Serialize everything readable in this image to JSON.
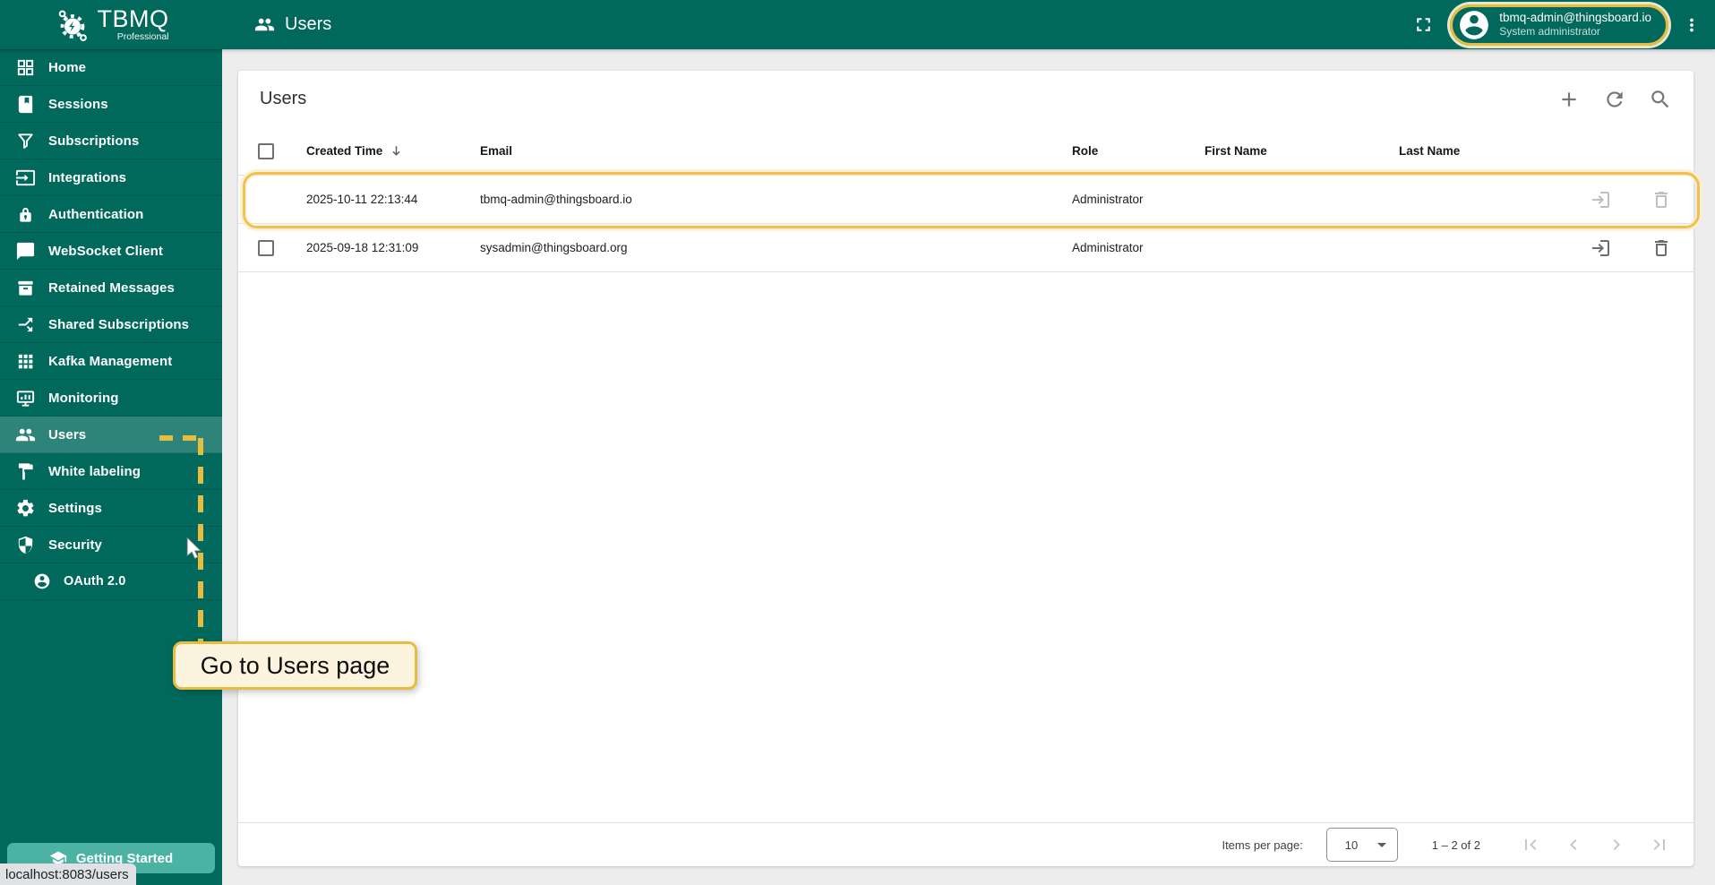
{
  "brand": {
    "name": "TBMQ",
    "edition": "Professional"
  },
  "topbar": {
    "page_title": "Users",
    "account": {
      "email": "tbmq-admin@thingsboard.io",
      "role": "System administrator"
    }
  },
  "sidebar": {
    "items": [
      {
        "label": "Home"
      },
      {
        "label": "Sessions"
      },
      {
        "label": "Subscriptions"
      },
      {
        "label": "Integrations"
      },
      {
        "label": "Authentication"
      },
      {
        "label": "WebSocket Client"
      },
      {
        "label": "Retained Messages"
      },
      {
        "label": "Shared Subscriptions"
      },
      {
        "label": "Kafka Management"
      },
      {
        "label": "Monitoring"
      },
      {
        "label": "Users"
      },
      {
        "label": "White labeling"
      },
      {
        "label": "Settings"
      },
      {
        "label": "Security"
      },
      {
        "label": "OAuth 2.0"
      }
    ],
    "active_item": "Users",
    "getting_started_label": "Getting Started"
  },
  "users_page": {
    "title": "Users",
    "table": {
      "columns": [
        "Created Time",
        "Email",
        "Role",
        "First Name",
        "Last Name"
      ],
      "rows": [
        {
          "created_time": "2025-10-11 22:13:44",
          "email": "tbmq-admin@thingsboard.io",
          "role": "Administrator",
          "first_name": "",
          "last_name": "",
          "highlighted": true
        },
        {
          "created_time": "2025-09-18 12:31:09",
          "email": "sysadmin@thingsboard.org",
          "role": "Administrator",
          "first_name": "",
          "last_name": "",
          "highlighted": false
        }
      ]
    },
    "pagination": {
      "items_per_page_label": "Items per page:",
      "page_size": "10",
      "range": "1 – 2 of 2"
    }
  },
  "annotations": {
    "tooltip_text": "Go to Users page"
  },
  "browser": {
    "status_url": "localhost:8083/users"
  },
  "colors": {
    "primary": "#00695C",
    "accent_gold": "#E6BD43",
    "highlight_border": "#F0C24B",
    "tooltip_bg": "#FCF4DE",
    "getting_started_bg": "#4BB2A4",
    "content_bg": "#EDEDED",
    "statusbar_bg": "#DFE1E5"
  }
}
